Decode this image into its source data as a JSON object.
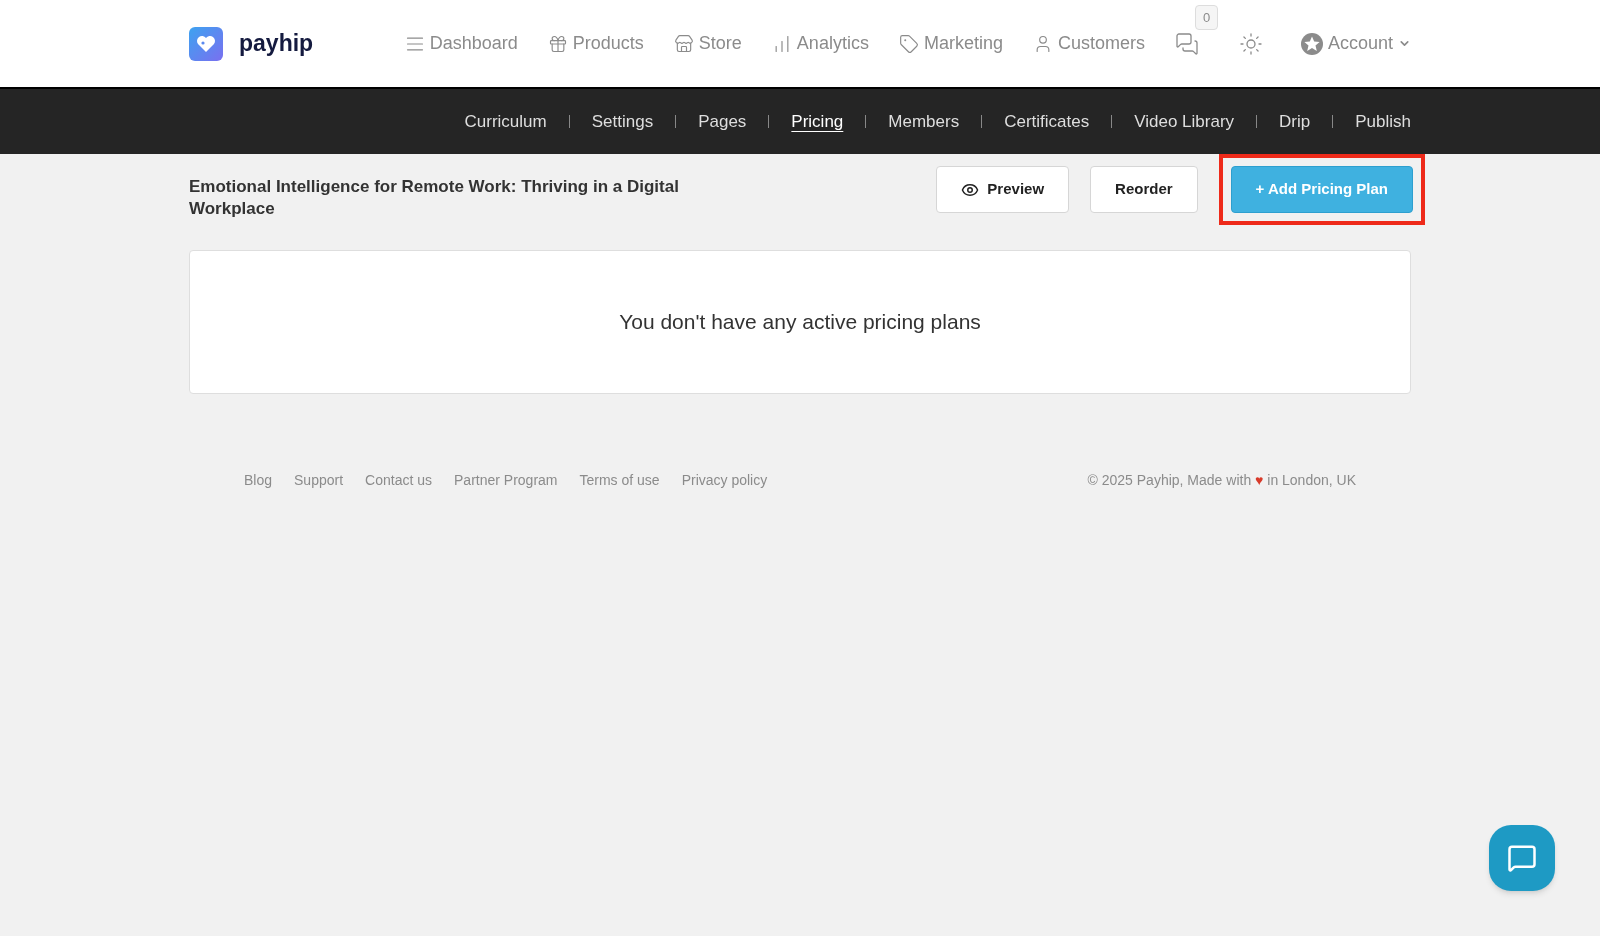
{
  "brand": {
    "name": "payhip"
  },
  "main_nav": [
    {
      "label": "Dashboard"
    },
    {
      "label": "Products"
    },
    {
      "label": "Store"
    },
    {
      "label": "Analytics"
    },
    {
      "label": "Marketing"
    },
    {
      "label": "Customers"
    }
  ],
  "messages": {
    "count": "0"
  },
  "account": {
    "label": "Account"
  },
  "course_nav": [
    {
      "label": "Curriculum",
      "selected": false
    },
    {
      "label": "Settings",
      "selected": false
    },
    {
      "label": "Pages",
      "selected": false
    },
    {
      "label": "Pricing",
      "selected": true
    },
    {
      "label": "Members",
      "selected": false
    },
    {
      "label": "Certificates",
      "selected": false
    },
    {
      "label": "Video Library",
      "selected": false
    },
    {
      "label": "Drip",
      "selected": false
    },
    {
      "label": "Publish",
      "selected": false
    }
  ],
  "course_title": "Emotional Intelligence for Remote Work: Thriving in a Digital Workplace",
  "actions": [
    {
      "label": "Preview",
      "kind": "preview",
      "highlighted": false
    },
    {
      "label": "Reorder",
      "kind": "plain",
      "highlighted": false
    },
    {
      "label": "+ Add Pricing Plan",
      "kind": "primary",
      "highlighted": true
    }
  ],
  "empty_message": "You don't have any active pricing plans",
  "footer": {
    "links": [
      "Blog",
      "Support",
      "Contact us",
      "Partner Program",
      "Terms of use",
      "Privacy policy"
    ],
    "copyright_before": "© 2025 Payhip, Made with",
    "heart": "♥",
    "copyright_after": "in London, UK"
  }
}
